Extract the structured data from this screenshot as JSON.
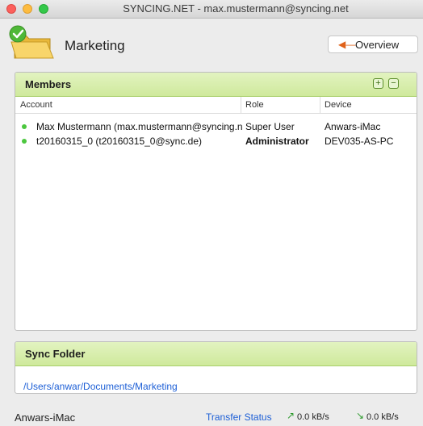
{
  "window": {
    "title": "SYNCING.NET - max.mustermann@syncing.net"
  },
  "header": {
    "title": "Marketing",
    "overview_label": "Overview"
  },
  "members": {
    "title": "Members",
    "columns": {
      "account": "Account",
      "role": "Role",
      "device": "Device"
    },
    "rows": [
      {
        "account": "Max Mustermann (max.mustermann@syncing.net)",
        "role": "Super User",
        "device": "Anwars-iMac",
        "role_bold": false
      },
      {
        "account": "t20160315_0 (t20160315_0@sync.de)",
        "role": "Administrator",
        "device": "DEV035-AS-PC",
        "role_bold": true
      }
    ]
  },
  "sync_folder": {
    "title": "Sync Folder",
    "path": "/Users/anwar/Documents/Marketing"
  },
  "status": {
    "device": "Anwars-iMac",
    "transfer_label": "Transfer Status",
    "upload": "0.0 kB/s",
    "download": "0.0 kB/s"
  },
  "colors": {
    "accent_green": "#cfe99c",
    "link": "#1d5fd6",
    "online_dot": "#4cc73f"
  },
  "icons": [
    "folder-check-icon",
    "arrow-left-icon",
    "add-icon",
    "remove-icon",
    "upload-arrow-icon",
    "download-arrow-icon"
  ]
}
